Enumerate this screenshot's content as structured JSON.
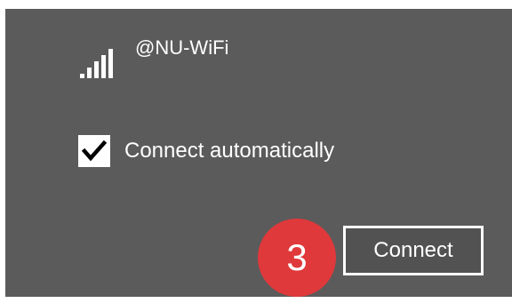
{
  "wifi_panel": {
    "network": {
      "name": "@NU-WiFi",
      "signal_icon": "wifi-signal-bars-icon"
    },
    "auto_connect": {
      "label": "Connect automatically",
      "checked": true,
      "check_icon": "checkmark-icon"
    },
    "step_badge": {
      "number": "3",
      "color": "#e0393b"
    },
    "connect_button": {
      "label": "Connect"
    }
  },
  "colors": {
    "panel_background": "#5b5b5b",
    "text": "#ffffff",
    "badge": "#e0393b"
  }
}
